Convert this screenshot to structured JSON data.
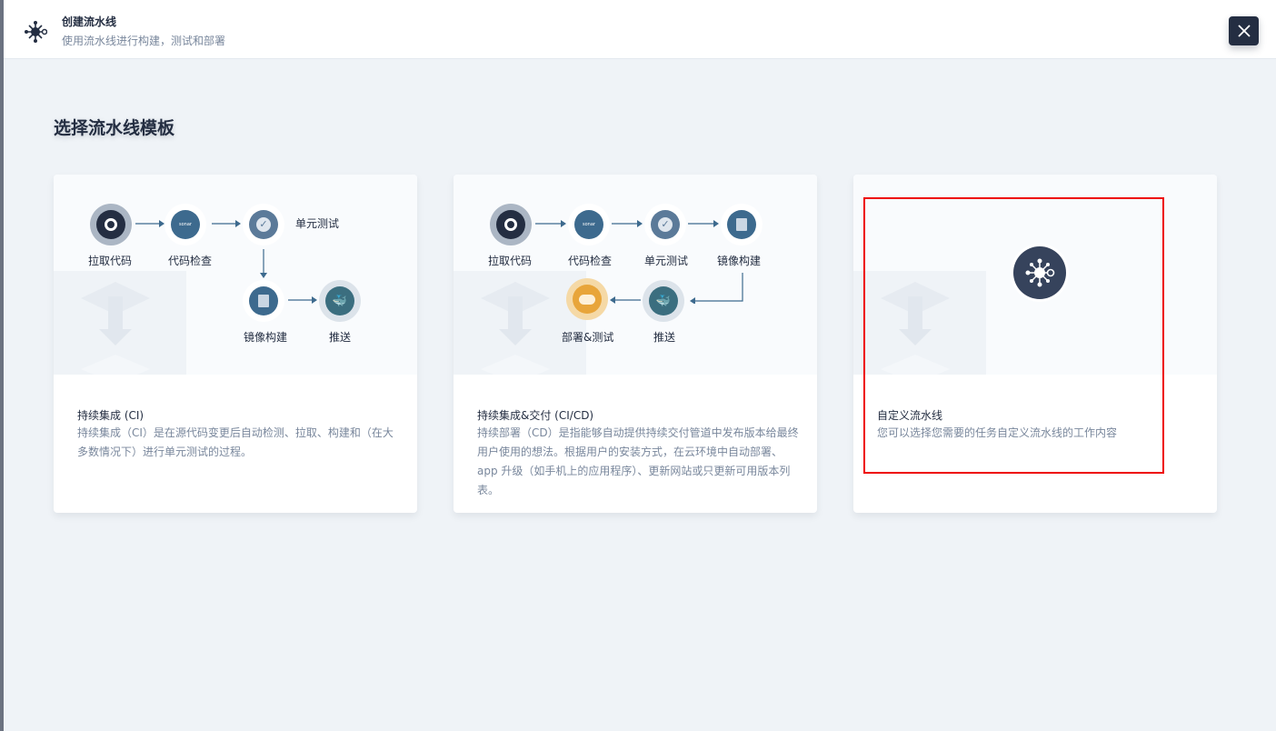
{
  "header": {
    "title": "创建流水线",
    "subtitle": "使用流水线进行构建，测试和部署",
    "icon": "pipeline-icon",
    "close_icon": "close-icon"
  },
  "section_title": "选择流水线模板",
  "cards": [
    {
      "name": "持续集成 (CI)",
      "description": "持续集成（CI）是在源代码变更后自动检测、拉取、构建和（在大多数情况下）进行单元测试的过程。",
      "steps": [
        "拉取代码",
        "代码检查",
        "单元测试",
        "镜像构建",
        "推送"
      ]
    },
    {
      "name": "持续集成&交付 (CI/CD)",
      "description": "持续部署（CD）是指能够自动提供持续交付管道中发布版本给最终用户使用的想法。根据用户的安装方式，在云环境中自动部署、app 升级（如手机上的应用程序）、更新网站或只更新可用版本列表。",
      "steps": [
        "拉取代码",
        "代码检查",
        "单元测试",
        "镜像构建",
        "推送",
        "部署&测试"
      ]
    },
    {
      "name": "自定义流水线",
      "description": "您可以选择您需要的任务自定义流水线的工作内容",
      "icon": "custom-pipeline-icon"
    }
  ],
  "selection_color": "#e00000"
}
